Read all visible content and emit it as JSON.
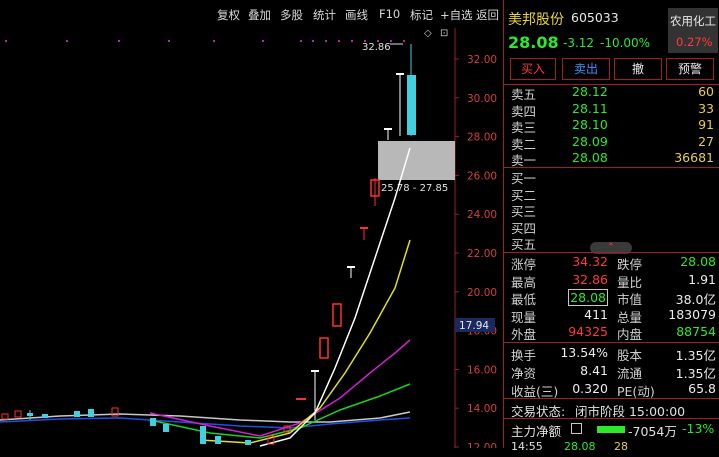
{
  "toolbar": {
    "items": [
      "复权",
      "叠加",
      "多股",
      "统计",
      "画线",
      "F10",
      "标记",
      "+自选",
      "返回"
    ]
  },
  "chart": {
    "y_ticks": [
      "32.00",
      "30.00",
      "28.00",
      "26.00",
      "24.00",
      "22.00",
      "20.00",
      "18.00",
      "16.00",
      "14.00",
      "12.00"
    ],
    "high_label": "32.86",
    "range_label": "25.78 - 27.85",
    "current_price_tag": "17.94",
    "diamond": "◇",
    "scroll_icon": "⊡"
  },
  "stock": {
    "name": "美邦股份",
    "code": "605033",
    "industry": "农用化工",
    "industry_pct": "0.27%",
    "price": "28.08",
    "change": "-3.12",
    "change_pct": "-10.00%"
  },
  "buttons": {
    "buy": "买入",
    "sell": "卖出",
    "cancel": "撤",
    "alert": "预警"
  },
  "sell_book": [
    {
      "label": "卖五",
      "price": "28.12",
      "vol": "60"
    },
    {
      "label": "卖四",
      "price": "28.11",
      "vol": "33"
    },
    {
      "label": "卖三",
      "price": "28.10",
      "vol": "91"
    },
    {
      "label": "卖二",
      "price": "28.09",
      "vol": "27"
    },
    {
      "label": "卖一",
      "price": "28.08",
      "vol": "36681"
    }
  ],
  "buy_book": [
    {
      "label": "买一"
    },
    {
      "label": "买二"
    },
    {
      "label": "买三"
    },
    {
      "label": "买四"
    },
    {
      "label": "买五"
    }
  ],
  "collapse_icon": "⌃",
  "stats": [
    {
      "l1": "涨停",
      "v1": "34.32",
      "l2": "跌停",
      "v2": "28.08"
    },
    {
      "l1": "最高",
      "v1": "32.86",
      "l2": "量比",
      "v2": "1.91"
    },
    {
      "l1": "最低",
      "v1": "28.08",
      "l2": "市值",
      "v2": "38.0亿"
    },
    {
      "l1": "现量",
      "v1": "411",
      "l2": "总量",
      "v2": "183079"
    },
    {
      "l1": "外盘",
      "v1": "94325",
      "l2": "内盘",
      "v2": "88754"
    }
  ],
  "stats2": [
    {
      "l1": "换手",
      "v1": "13.54%",
      "l2": "股本",
      "v2": "1.35亿"
    },
    {
      "l1": "净资",
      "v1": "8.41",
      "l2": "流通",
      "v2": "1.35亿"
    },
    {
      "l1": "收益(三)",
      "v1": "0.320",
      "l2": "PE(动)",
      "v2": "65.8"
    }
  ],
  "status": {
    "label": "交易状态:",
    "value": "闭市阶段 15:00:00"
  },
  "main_flow": {
    "label": "主力净额",
    "value": "-7054万",
    "pct": "-13%"
  },
  "bottom_row": {
    "time": "14:55",
    "price": "28.08",
    "vol": "28"
  }
}
